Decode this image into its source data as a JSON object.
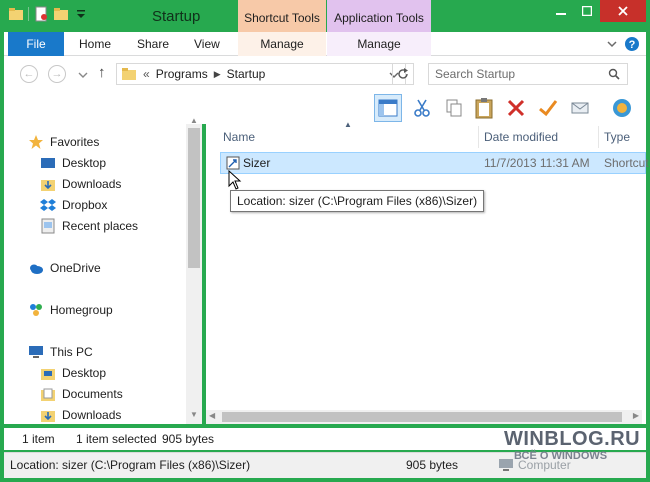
{
  "window": {
    "title": "Startup",
    "context_tabs": [
      "Shortcut Tools",
      "Application Tools"
    ],
    "controls": [
      "minimize",
      "maximize",
      "close"
    ]
  },
  "ribbon": {
    "tabs": [
      "File",
      "Home",
      "Share",
      "View",
      "Manage",
      "Manage"
    ]
  },
  "address": {
    "back": "←",
    "forward": "→",
    "up": "↑",
    "overflow": "«",
    "crumbs": [
      "Programs",
      "Startup"
    ],
    "search_placeholder": "Search Startup"
  },
  "nav": {
    "items": [
      {
        "label": "Favorites",
        "icon": "star-icon"
      },
      {
        "label": "Desktop",
        "icon": "desktop-icon"
      },
      {
        "label": "Downloads",
        "icon": "downloads-icon"
      },
      {
        "label": "Dropbox",
        "icon": "dropbox-icon"
      },
      {
        "label": "Recent places",
        "icon": "recent-places-icon"
      },
      {
        "label": "OneDrive",
        "icon": "onedrive-icon"
      },
      {
        "label": "Homegroup",
        "icon": "homegroup-icon"
      },
      {
        "label": "This PC",
        "icon": "pc-icon"
      },
      {
        "label": "Desktop",
        "icon": "desktop-folder-icon"
      },
      {
        "label": "Documents",
        "icon": "documents-folder-icon"
      },
      {
        "label": "Downloads",
        "icon": "downloads-folder-icon"
      }
    ]
  },
  "list": {
    "columns": [
      "Name",
      "Date modified",
      "Type"
    ],
    "rows": [
      {
        "name": "Sizer",
        "date": "11/7/2013 11:31 AM",
        "type": "Shortcut"
      }
    ],
    "tooltip": "Location: sizer (C:\\Program Files (x86)\\Sizer)"
  },
  "status": {
    "count": "1 item",
    "selected": "1 item selected",
    "size": "905 bytes"
  },
  "details": {
    "location": "Location: sizer (C:\\Program Files (x86)\\Sizer)",
    "size": "905 bytes",
    "zone": "Computer"
  },
  "watermark": {
    "line1": "WINBLOG.RU",
    "line2": "ВСЁ О WINDOWS"
  },
  "colors": {
    "frame": "#27a94f",
    "file_tab": "#1979ca",
    "selection": "#cce8ff",
    "close_button": "#c7302a",
    "shortcut_tools": "#f7c9a8",
    "application_tools": "#e1c2ee"
  }
}
